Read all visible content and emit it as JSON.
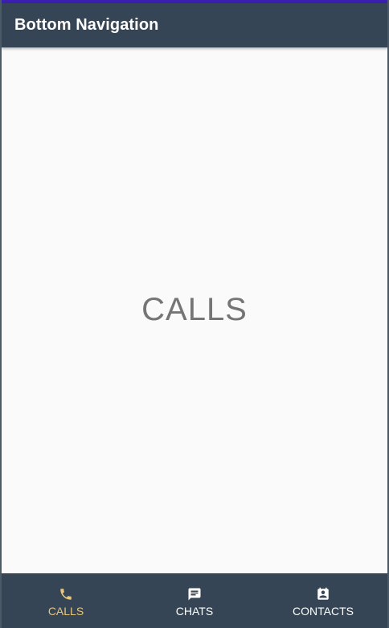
{
  "app_bar": {
    "title": "Bottom Navigation"
  },
  "content": {
    "label": "CALLS"
  },
  "bottom_nav": {
    "active_color": "#e9c77b",
    "inactive_color": "#ffffff",
    "items": [
      {
        "label": "CALLS",
        "icon": "phone-icon",
        "active": true
      },
      {
        "label": "CHATS",
        "icon": "chat-icon",
        "active": false
      },
      {
        "label": "CONTACTS",
        "icon": "contacts-icon",
        "active": false
      }
    ]
  }
}
